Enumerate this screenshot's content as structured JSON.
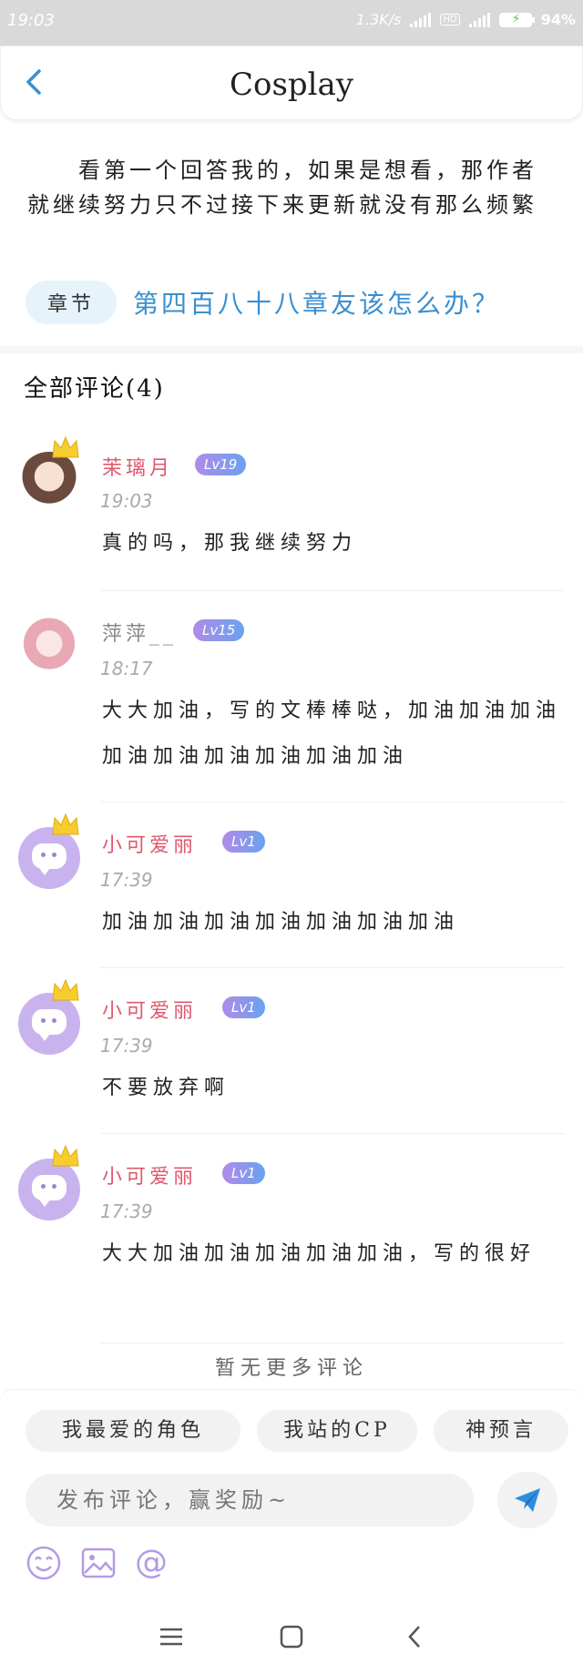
{
  "status_bar": {
    "time": "19:03",
    "net_speed": "1.3K/s",
    "battery": "94%"
  },
  "header": {
    "title": "Cosplay"
  },
  "intro": {
    "text": "看第一个回答我的，如果是想看，那作者就继续努力只不过接下来更新就没有那么频繁",
    "chapter_tag": "章节",
    "chapter_link": "第四百八十八章友该怎么办？"
  },
  "comments": {
    "title": "全部评论(4)",
    "items": [
      {
        "user": "茉璃月",
        "level": "Lv19",
        "time": "19:03",
        "text": "真的吗，那我继续努力"
      },
      {
        "user": "萍萍__",
        "level": "Lv15",
        "time": "18:17",
        "text": "大大加油，写的文棒棒哒，加油加油加油加油加油加油加油加油加油"
      },
      {
        "user": "小可爱丽",
        "level": "Lv1",
        "time": "17:39",
        "text": "加油加油加油加油加油加油加油"
      },
      {
        "user": "小可爱丽",
        "level": "Lv1",
        "time": "17:39",
        "text": "不要放弃啊"
      },
      {
        "user": "小可爱丽",
        "level": "Lv1",
        "time": "17:39",
        "text": "大大加油加油加油加油加油，写的很好"
      }
    ],
    "no_more": "暂无更多评论"
  },
  "composer": {
    "chips": [
      "我最爱的角色",
      "我站的CP",
      "神预言"
    ],
    "placeholder": "发布评论，赢奖励~"
  },
  "colors": {
    "accent": "#3a8fd0",
    "username": "#e0586b",
    "level_badge_from": "#b08be8",
    "level_badge_to": "#6aa2ef"
  },
  "icons": [
    "back-arrow-icon",
    "send-icon",
    "emoji-icon",
    "image-icon",
    "at-icon",
    "crown-icon",
    "menu-icon",
    "home-icon",
    "nav-back-icon"
  ]
}
